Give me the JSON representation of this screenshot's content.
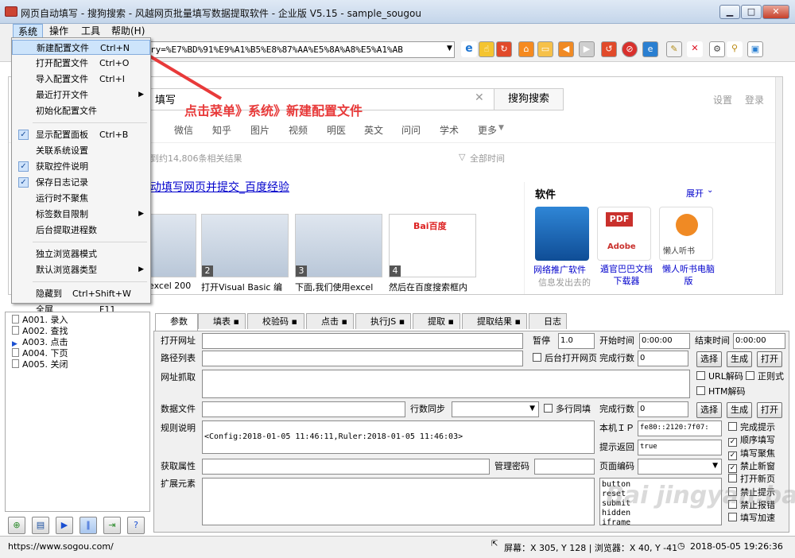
{
  "window": {
    "title": "网页自动填写 - 搜狗搜索 - 风越网页批量填写数据提取软件 - 企业版 V5.15 - sample_sougou"
  },
  "menubar": [
    "系统",
    "操作",
    "工具",
    "帮助(H)"
  ],
  "address": {
    "url": "ry=%E7%BD%91%E9%A1%B5%E8%87%AA%E5%8A%A8%E5%A1%AB"
  },
  "system_menu": [
    {
      "label": "新建配置文件",
      "shortcut": "Ctrl+N",
      "highlighted": true
    },
    {
      "label": "打开配置文件",
      "shortcut": "Ctrl+O"
    },
    {
      "label": "导入配置文件",
      "shortcut": "Ctrl+I"
    },
    {
      "label": "最近打开文件",
      "submenu": true
    },
    {
      "label": "初始化配置文件"
    },
    {
      "separator": true
    },
    {
      "label": "显示配置面板",
      "shortcut": "Ctrl+B",
      "checked": true
    },
    {
      "label": "关联系统设置"
    },
    {
      "label": "获取控件说明",
      "checked": true
    },
    {
      "label": "保存日志记录",
      "checked": true
    },
    {
      "label": "运行时不聚焦"
    },
    {
      "label": "标签数目限制",
      "submenu": true
    },
    {
      "label": "后台提取进程数"
    },
    {
      "separator": true
    },
    {
      "label": "独立浏览器模式"
    },
    {
      "label": "默认浏览器类型",
      "submenu": true
    },
    {
      "separator": true
    },
    {
      "label": "隐藏到",
      "shortcut": "Ctrl+Shift+W"
    },
    {
      "label": "全屏",
      "shortcut": "F11"
    }
  ],
  "annotation": "点击菜单》系统》新建配置文件",
  "browser": {
    "query_partial": "填写",
    "search_button": "搜狗搜索",
    "top_links": [
      "设置",
      "登录"
    ],
    "tabs": [
      "微信",
      "知乎",
      "图片",
      "视频",
      "明医",
      "英文",
      "问问",
      "学术",
      "更多"
    ],
    "result_count": "到约14,806条相关结果",
    "time_filter": "全部时间",
    "result_title": "动填写网页并提交_百度经验",
    "thumb_captions": [
      "excel 200",
      "打开Visual Basic 编",
      "下面,我们使用excel",
      "然后在百度搜索框内"
    ],
    "thumb_numbers": [
      "2",
      "3",
      "4"
    ],
    "baidu_logo": "Bai百度",
    "software": {
      "heading": "软件",
      "expand": "展开",
      "pdf_label": "PDF",
      "adobe_label": "Adobe",
      "items": [
        {
          "name": "网络推广软件",
          "desc": "信息发出去的"
        },
        {
          "name": "遁官巴巴文档下载器"
        },
        {
          "name": "懒人听书电脑版",
          "logo_text": "懒人听书"
        }
      ]
    }
  },
  "tree": [
    "A001. 录入",
    "A002. 查找",
    "A003. 点击",
    "A004. 下页",
    "A005. 关闭"
  ],
  "bottom_tabs": [
    "参数",
    "填表",
    "校验码",
    "点击",
    "执行JS",
    "提取",
    "提取结果",
    "日志"
  ],
  "form": {
    "open_url": "打开网址",
    "pause": "暂停",
    "pause_val": "1.0",
    "start_time": "开始时间",
    "start_time_val": "0:00:00",
    "end_time": "结束时间",
    "end_time_val": "0:00:00",
    "path_list": "路径列表",
    "bg_open": "后台打开网页",
    "done_rows": "完成行数",
    "done_rows_val": "0",
    "select": "选择",
    "generate": "生成",
    "open": "打开",
    "url_capture": "网址抓取",
    "url_decode": "URL解码",
    "regex": "正则式",
    "html_decode": "HTM解码",
    "data_file": "数据文件",
    "row_sync": "行数同步",
    "multi_fill": "多行同填",
    "rule_desc": "规则说明",
    "rule_text": "<Config:2018-01-05 11:46:11,Ruler:2018-01-05 11:46:03>",
    "local_ip": "本机ＩＰ",
    "ip_val": "fe80::2120:7f07:",
    "prompt_return": "提示返回",
    "prompt_val": "true",
    "get_attr": "获取属性",
    "admin_pwd": "管理密码",
    "page_encoding": "页面编码",
    "ext_elem": "扩展元素",
    "ext_list": [
      "button",
      "reset",
      "submit",
      "hidden",
      "iframe"
    ],
    "checkboxes": [
      {
        "label": "完成提示",
        "checked": false
      },
      {
        "label": "顺序填写",
        "checked": true
      },
      {
        "label": "填写聚焦",
        "checked": true
      },
      {
        "label": "禁止新窗",
        "checked": true
      },
      {
        "label": "打开新页",
        "checked": false
      },
      {
        "label": "禁止提示",
        "checked": false
      },
      {
        "label": "禁止报错",
        "checked": false
      },
      {
        "label": "填写加速",
        "checked": false
      }
    ]
  },
  "status": {
    "url": "https://www.sogou.com/",
    "coords": "屏幕：X 305, Y 128 | 浏览器：X 40, Y -41",
    "datetime": "2018-05-05 19:26:36"
  },
  "watermark": "Bai jingyan.baidu.com"
}
